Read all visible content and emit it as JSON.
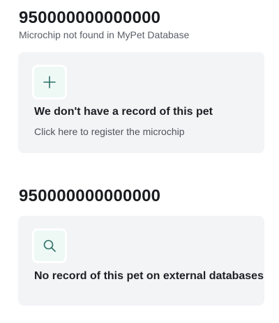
{
  "mypet_section": {
    "microchip_number": "950000000000000",
    "status_text": "Microchip not found in MyPet Database",
    "card": {
      "icon": "plus-icon",
      "title": "We don't have a record of this pet",
      "action_label": "Click here to register the microchip"
    }
  },
  "external_section": {
    "microchip_number": "950000000000000",
    "card": {
      "icon": "search-icon",
      "title": "No record of this pet on external databases"
    }
  },
  "colors": {
    "icon_stroke": "#2f6f66",
    "icon_tile_bg": "#eef9f6",
    "card_bg": "#f3f4f6"
  }
}
